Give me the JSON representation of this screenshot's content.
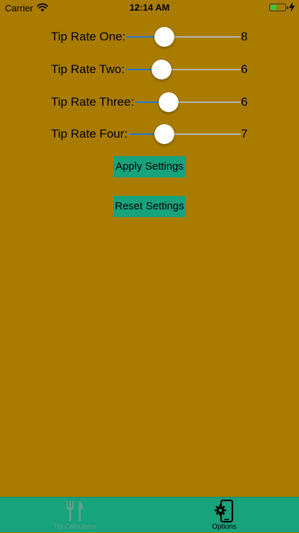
{
  "status_bar": {
    "carrier": "Carrier",
    "time": "12:14 AM",
    "battery_level": 0.4,
    "battery_color": "#2ecc40"
  },
  "sliders": [
    {
      "label": "Tip Rate One:",
      "value": "8",
      "fraction": 0.3
    },
    {
      "label": "Tip Rate Two:",
      "value": "6",
      "fraction": 0.27
    },
    {
      "label": "Tip Rate Three:",
      "value": "6",
      "fraction": 0.27
    },
    {
      "label": "Tip Rate Four:",
      "value": "7",
      "fraction": 0.28
    }
  ],
  "buttons": {
    "apply_label": "Apply Settings",
    "reset_label": "Reset Settings"
  },
  "tab_bar": {
    "tabs": [
      {
        "label": "Tip Calculator",
        "icon": "fork-knife-icon",
        "active": false
      },
      {
        "label": "Options",
        "icon": "phone-gear-icon",
        "active": true
      }
    ]
  },
  "colors": {
    "background": "#A97C00",
    "accent": "#17A37B",
    "slider_min_track": "#1f7bd1",
    "slider_max_track": "#b6b6b6"
  }
}
